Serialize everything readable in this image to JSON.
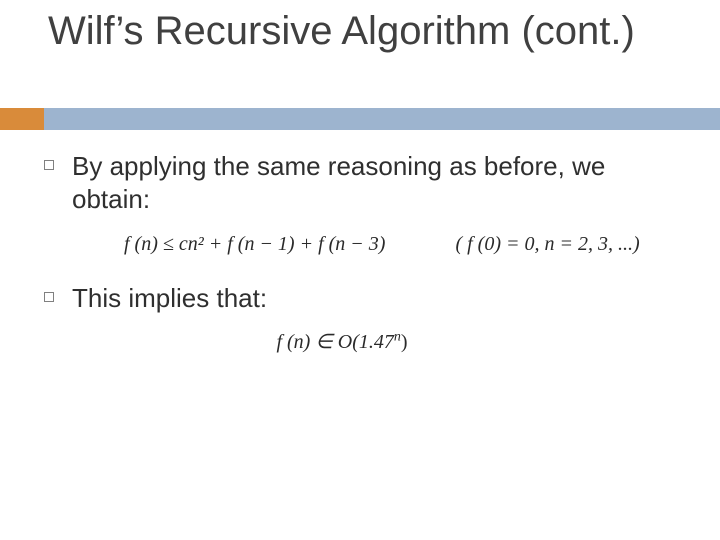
{
  "title": "Wilf’s Recursive Algorithm (cont.)",
  "bullets": [
    {
      "text": "By applying the same reasoning as before, we obtain:"
    },
    {
      "text": "This implies that:"
    }
  ],
  "formulas": {
    "recurrence": "f (n) ≤ cn² + f (n − 1) + f (n − 3)",
    "side_condition": "( f (0) = 0, n = 2, 3, ...)",
    "complexity_prefix": "f (n) ∈ O(1.47",
    "complexity_exp": "n",
    "complexity_suffix": ")"
  }
}
